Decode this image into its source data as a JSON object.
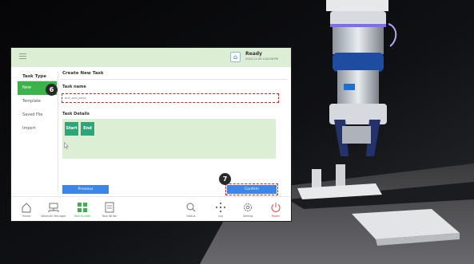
{
  "status": {
    "title": "Ready",
    "time": "2020-11-09 4:20:58 PM"
  },
  "sidebar": {
    "heading": "Task Type",
    "items": [
      {
        "label": "New",
        "active": true
      },
      {
        "label": "Template",
        "active": false
      },
      {
        "label": "Saved File",
        "active": false
      },
      {
        "label": "Import",
        "active": false
      }
    ]
  },
  "main": {
    "title": "Create New Task",
    "task_name_label": "Task name",
    "task_name_value": "pick_and_place",
    "task_details_label": "Task Details",
    "chips": [
      "Start",
      "End"
    ],
    "previous_label": "Previous",
    "confirm_label": "Confirm"
  },
  "callouts": [
    "6",
    "7"
  ],
  "bottom_nav": [
    {
      "label": "Home",
      "icon": "home-icon"
    },
    {
      "label": "Workcell Manager",
      "icon": "workcell-icon"
    },
    {
      "label": "Task Builder",
      "icon": "task-builder-icon",
      "active": true
    },
    {
      "label": "Task Writer",
      "icon": "task-writer-icon"
    },
    {
      "label": "Status",
      "icon": "status-icon"
    },
    {
      "label": "Jog",
      "icon": "jog-icon"
    },
    {
      "label": "Setting",
      "icon": "setting-icon"
    },
    {
      "label": "Power",
      "icon": "power-icon"
    }
  ],
  "colors": {
    "accent_green": "#3bb34a",
    "button_blue": "#3b86e8",
    "highlight_red": "#e02020",
    "header_green": "#dcefd5"
  }
}
